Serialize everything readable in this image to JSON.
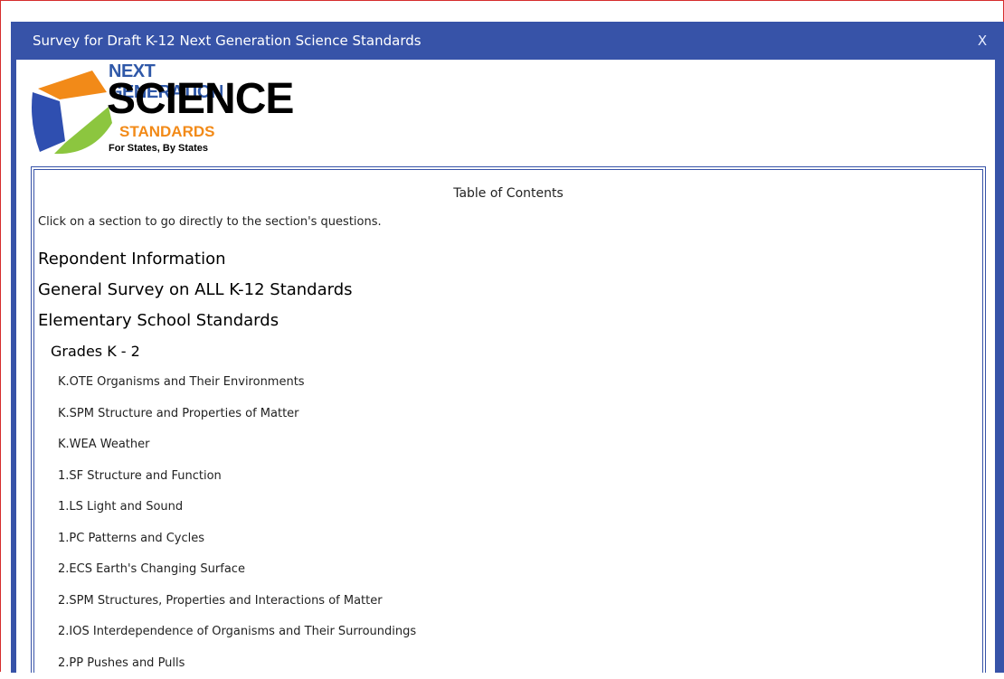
{
  "window": {
    "title": "Survey for Draft K-12 Next Generation Science Standards",
    "close_label": "X"
  },
  "logo": {
    "line1": "NEXT GENERATION",
    "line2": "SCIENCE",
    "line3": "STANDARDS",
    "line4": "For States, By States"
  },
  "toc": {
    "title": "Table of Contents",
    "intro": "Click on a section to go directly to the section's questions.",
    "sections": [
      {
        "label": "Repondent Information",
        "level": 1
      },
      {
        "label": "General Survey on ALL K-12 Standards",
        "level": 1
      },
      {
        "label": "Elementary School Standards",
        "level": 1
      },
      {
        "label": "Grades K - 2",
        "level": 2
      },
      {
        "label": "K.OTE Organisms and Their Environments",
        "level": 3
      },
      {
        "label": "K.SPM Structure and Properties of Matter",
        "level": 3
      },
      {
        "label": "K.WEA Weather",
        "level": 3
      },
      {
        "label": "1.SF Structure and Function",
        "level": 3
      },
      {
        "label": "1.LS Light and Sound",
        "level": 3
      },
      {
        "label": "1.PC Patterns and Cycles",
        "level": 3
      },
      {
        "label": "2.ECS Earth's Changing Surface",
        "level": 3
      },
      {
        "label": "2.SPM Structures, Properties and Interactions of Matter",
        "level": 3
      },
      {
        "label": "2.IOS Interdependence of Organisms and Their Surroundings",
        "level": 3
      },
      {
        "label": "2.PP Pushes and Pulls",
        "level": 3
      }
    ]
  },
  "colors": {
    "titlebar": "#3753a8",
    "frame_border": "#d62d2d"
  }
}
